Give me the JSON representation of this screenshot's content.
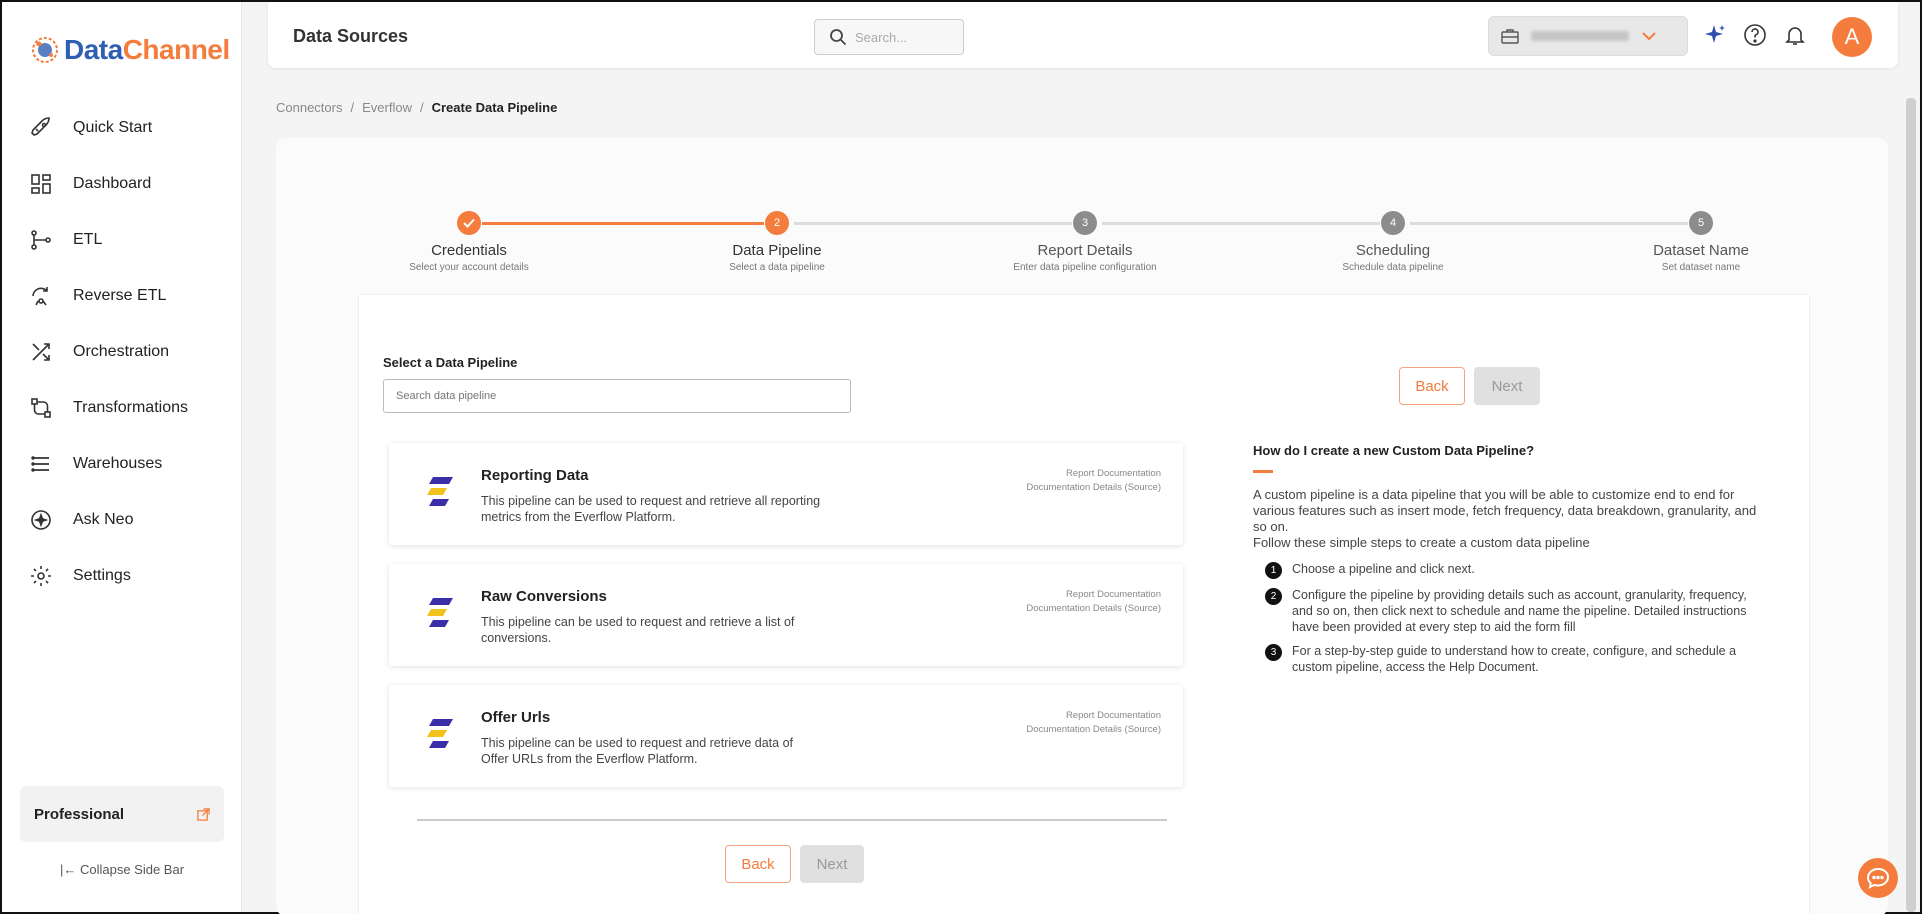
{
  "brand": {
    "part1": "Data",
    "part2": "Channel",
    "primary_color": "#f47c3c",
    "secondary_color": "#2f5fb0"
  },
  "sidebar": {
    "items": [
      {
        "label": "Quick Start",
        "icon": "rocket-icon"
      },
      {
        "label": "Dashboard",
        "icon": "dashboard-grid-icon"
      },
      {
        "label": "ETL",
        "icon": "etl-flow-icon"
      },
      {
        "label": "Reverse ETL",
        "icon": "reverse-etl-icon"
      },
      {
        "label": "Orchestration",
        "icon": "orchestration-icon"
      },
      {
        "label": "Transformations",
        "icon": "transformations-icon"
      },
      {
        "label": "Warehouses",
        "icon": "warehouse-stack-icon"
      },
      {
        "label": "Ask Neo",
        "icon": "sparkle-icon"
      },
      {
        "label": "Settings",
        "icon": "gear-icon"
      }
    ],
    "plan_label": "Professional",
    "collapse_label": "Collapse Side Bar"
  },
  "header": {
    "title": "Data Sources",
    "search_placeholder": "Search...",
    "avatar_initial": "A"
  },
  "breadcrumb": [
    "Connectors",
    "Everflow",
    "Create Data Pipeline"
  ],
  "stepper": [
    {
      "number": "1",
      "title": "Credentials",
      "subtitle": "Select your account details",
      "state": "done"
    },
    {
      "number": "2",
      "title": "Data Pipeline",
      "subtitle": "Select a data pipeline",
      "state": "active"
    },
    {
      "number": "3",
      "title": "Report Details",
      "subtitle": "Enter data pipeline configuration",
      "state": "pending"
    },
    {
      "number": "4",
      "title": "Scheduling",
      "subtitle": "Schedule data pipeline",
      "state": "pending"
    },
    {
      "number": "5",
      "title": "Dataset Name",
      "subtitle": "Set dataset name",
      "state": "pending"
    }
  ],
  "pipeline": {
    "select_label": "Select a Data Pipeline",
    "search_placeholder": "Search data pipeline",
    "back_label": "Back",
    "next_label": "Next",
    "cards": [
      {
        "title": "Reporting Data",
        "description": "This pipeline can be used to request and retrieve all reporting metrics from the Everflow Platform.",
        "link1": "Report Documentation",
        "link2": "Documentation Details (Source)"
      },
      {
        "title": "Raw Conversions",
        "description": "This pipeline can be used to request and retrieve a list of conversions.",
        "link1": "Report Documentation",
        "link2": "Documentation Details (Source)"
      },
      {
        "title": "Offer Urls",
        "description": "This pipeline can be used to request and retrieve data of Offer URLs from the Everflow Platform.",
        "link1": "Report Documentation",
        "link2": "Documentation Details (Source)"
      }
    ]
  },
  "help": {
    "title": "How do I create a new Custom Data Pipeline?",
    "paragraph1": "A custom pipeline is a data pipeline that you will be able to customize end to end for various features such as insert mode, fetch frequency, data breakdown, granularity, and so on.",
    "paragraph2": "Follow these simple steps to create a custom data pipeline",
    "steps": [
      {
        "n": "1",
        "text": "Choose a pipeline and click next."
      },
      {
        "n": "2",
        "text": "Configure the pipeline by providing details such as account, granularity, frequency, and so on, then click next to schedule and name the pipeline. Detailed instructions have been provided at every step to aid the form fill"
      },
      {
        "n": "3",
        "text": "For a step-by-step guide to understand how to create, configure, and schedule a custom pipeline, access the Help Document."
      }
    ]
  }
}
